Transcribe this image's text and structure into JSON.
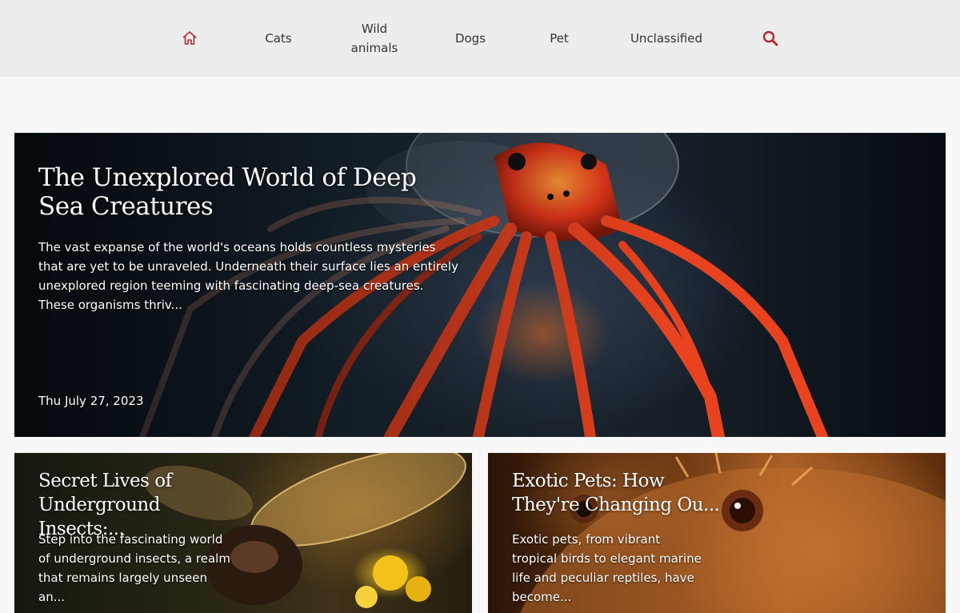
{
  "nav": {
    "items": [
      {
        "icon": "home-icon"
      },
      {
        "label": "Cats"
      },
      {
        "label_line1": "Wild",
        "label_line2": "animals"
      },
      {
        "label": "Dogs"
      },
      {
        "label": "Pet"
      },
      {
        "label": "Unclassified"
      },
      {
        "icon": "search-icon"
      }
    ],
    "accent_color": "#b3282d"
  },
  "featured": {
    "title": "The Unexplored World of Deep Sea Creatures",
    "excerpt": "The vast expanse of the world's oceans holds countless mysteries that are yet to be unraveled. Underneath their surface lies an entirely unexplored region teeming with fascinating deep-sea creatures. These organisms thriv...",
    "date": "Thu July 27, 2023"
  },
  "cards": [
    {
      "title": "Secret Lives of Underground Insects:...",
      "excerpt": "Step into the fascinating world of underground insects, a realm that remains largely unseen an..."
    },
    {
      "title": "Exotic Pets: How They're Changing Ou...",
      "excerpt": "Exotic pets, from vibrant tropical birds to elegant marine life and peculiar reptiles, have become..."
    }
  ]
}
